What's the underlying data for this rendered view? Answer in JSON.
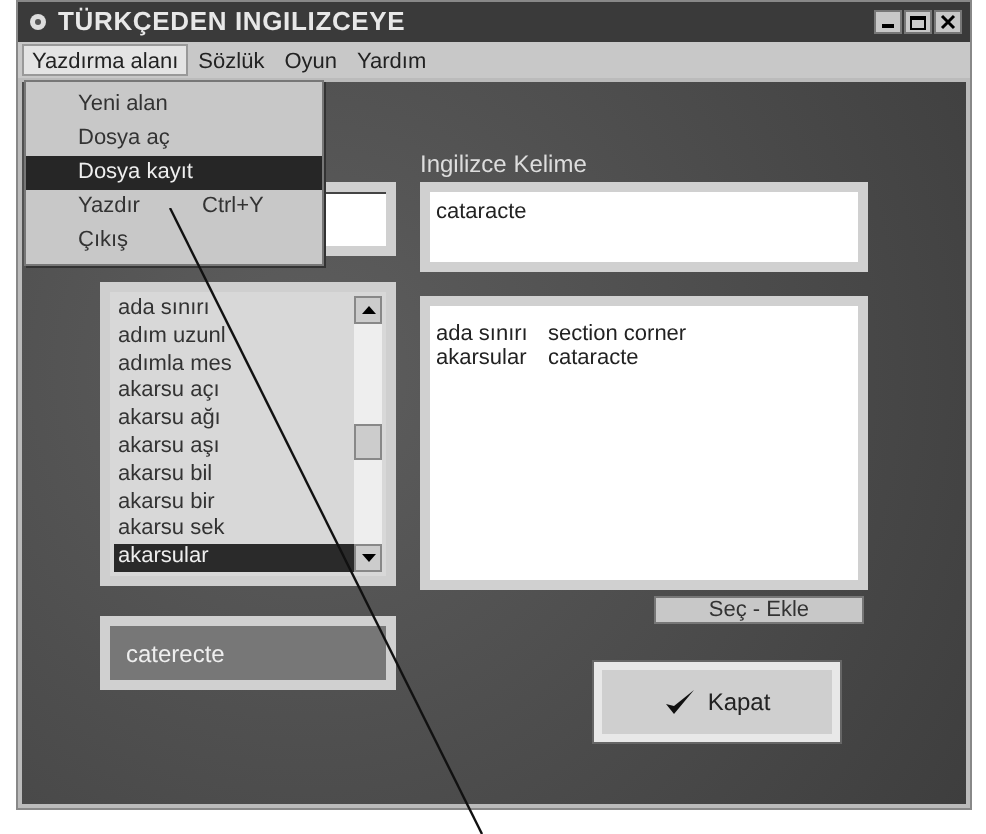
{
  "window": {
    "title": "TÜRKÇEDEN INGILIZCEYE"
  },
  "menu_bar": [
    {
      "label": "Yazdırma alanı",
      "selected": true
    },
    {
      "label": "Sözlük",
      "selected": false
    },
    {
      "label": "Oyun",
      "selected": false
    },
    {
      "label": "Yardım",
      "selected": false
    }
  ],
  "menu": {
    "items": [
      {
        "label": "Yeni alan",
        "selected": false
      },
      {
        "label": "Dosya aç",
        "selected": false
      },
      {
        "label": "Dosya kayıt",
        "selected": true
      },
      {
        "label": "Yazdır",
        "shortcut": "Ctrl+Y",
        "selected": false
      },
      {
        "label": "Çıkış",
        "selected": false
      }
    ]
  },
  "english_label": "Ingilizce Kelime",
  "english_word": {
    "value": "cataracte"
  },
  "word_list": {
    "items": [
      {
        "label": "ada sınırı",
        "selected": false
      },
      {
        "label": "adım uzunl",
        "selected": false
      },
      {
        "label": "adımla mes",
        "selected": false
      },
      {
        "label": "akarsu açı",
        "selected": false
      },
      {
        "label": "akarsu ağı",
        "selected": false
      },
      {
        "label": "akarsu aşı",
        "selected": false
      },
      {
        "label": "akarsu bil",
        "selected": false
      },
      {
        "label": "akarsu bir",
        "selected": false
      },
      {
        "label": "akarsu sek",
        "selected": false
      },
      {
        "label": "akarsular",
        "selected": true
      }
    ]
  },
  "results": [
    {
      "turkish": "ada sınırı",
      "english": "section corner"
    },
    {
      "turkish": "akarsular",
      "english": "cataracte"
    }
  ],
  "select_add_button": "Seç - Ekle",
  "result_field": {
    "value": "caterecte"
  },
  "close_button": "Kapat"
}
